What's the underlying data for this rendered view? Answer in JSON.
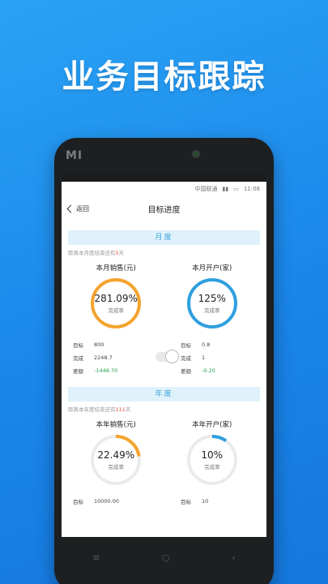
{
  "promo": {
    "title": "业务目标跟踪"
  },
  "device": {
    "brand": "MI"
  },
  "status_bar": {
    "carrier": "中国联通",
    "time": "11:08"
  },
  "nav": {
    "back_label": "返回",
    "title": "目标进度"
  },
  "monthly": {
    "header": "月度",
    "countdown_prefix": "距离本月度结束还有",
    "countdown_value": "5",
    "countdown_suffix": "天",
    "sales": {
      "title": "本月销售(元)",
      "value": "281.09%",
      "label": "完成率",
      "progress": 1.0,
      "color": "#f5a32d",
      "rows": [
        {
          "k": "目标",
          "v": "800"
        },
        {
          "k": "完成",
          "v": "2248.7"
        },
        {
          "k": "差额",
          "v": "-1448.70"
        }
      ]
    },
    "accounts": {
      "title": "本月开户(家)",
      "value": "125%",
      "label": "完成率",
      "progress": 1.0,
      "color": "#2f9fe0",
      "rows": [
        {
          "k": "目标",
          "v": "0.8"
        },
        {
          "k": "完成",
          "v": "1"
        },
        {
          "k": "差额",
          "v": "-0.20"
        }
      ]
    }
  },
  "yearly": {
    "header": "年度",
    "countdown_prefix": "距离本年度结束还有",
    "countdown_value": "111",
    "countdown_suffix": "天",
    "sales": {
      "title": "本年销售(元)",
      "value": "22.49%",
      "label": "完成率",
      "progress": 0.2249,
      "color": "#f5a32d",
      "rows": [
        {
          "k": "目标",
          "v": "10000.00"
        }
      ]
    },
    "accounts": {
      "title": "本年开户(家)",
      "value": "10%",
      "label": "完成率",
      "progress": 0.1,
      "color": "#2f9fe0",
      "rows": [
        {
          "k": "目标",
          "v": "10"
        }
      ]
    }
  },
  "phone_nav": {
    "menu": "≡",
    "home": "○",
    "back": "‹"
  }
}
